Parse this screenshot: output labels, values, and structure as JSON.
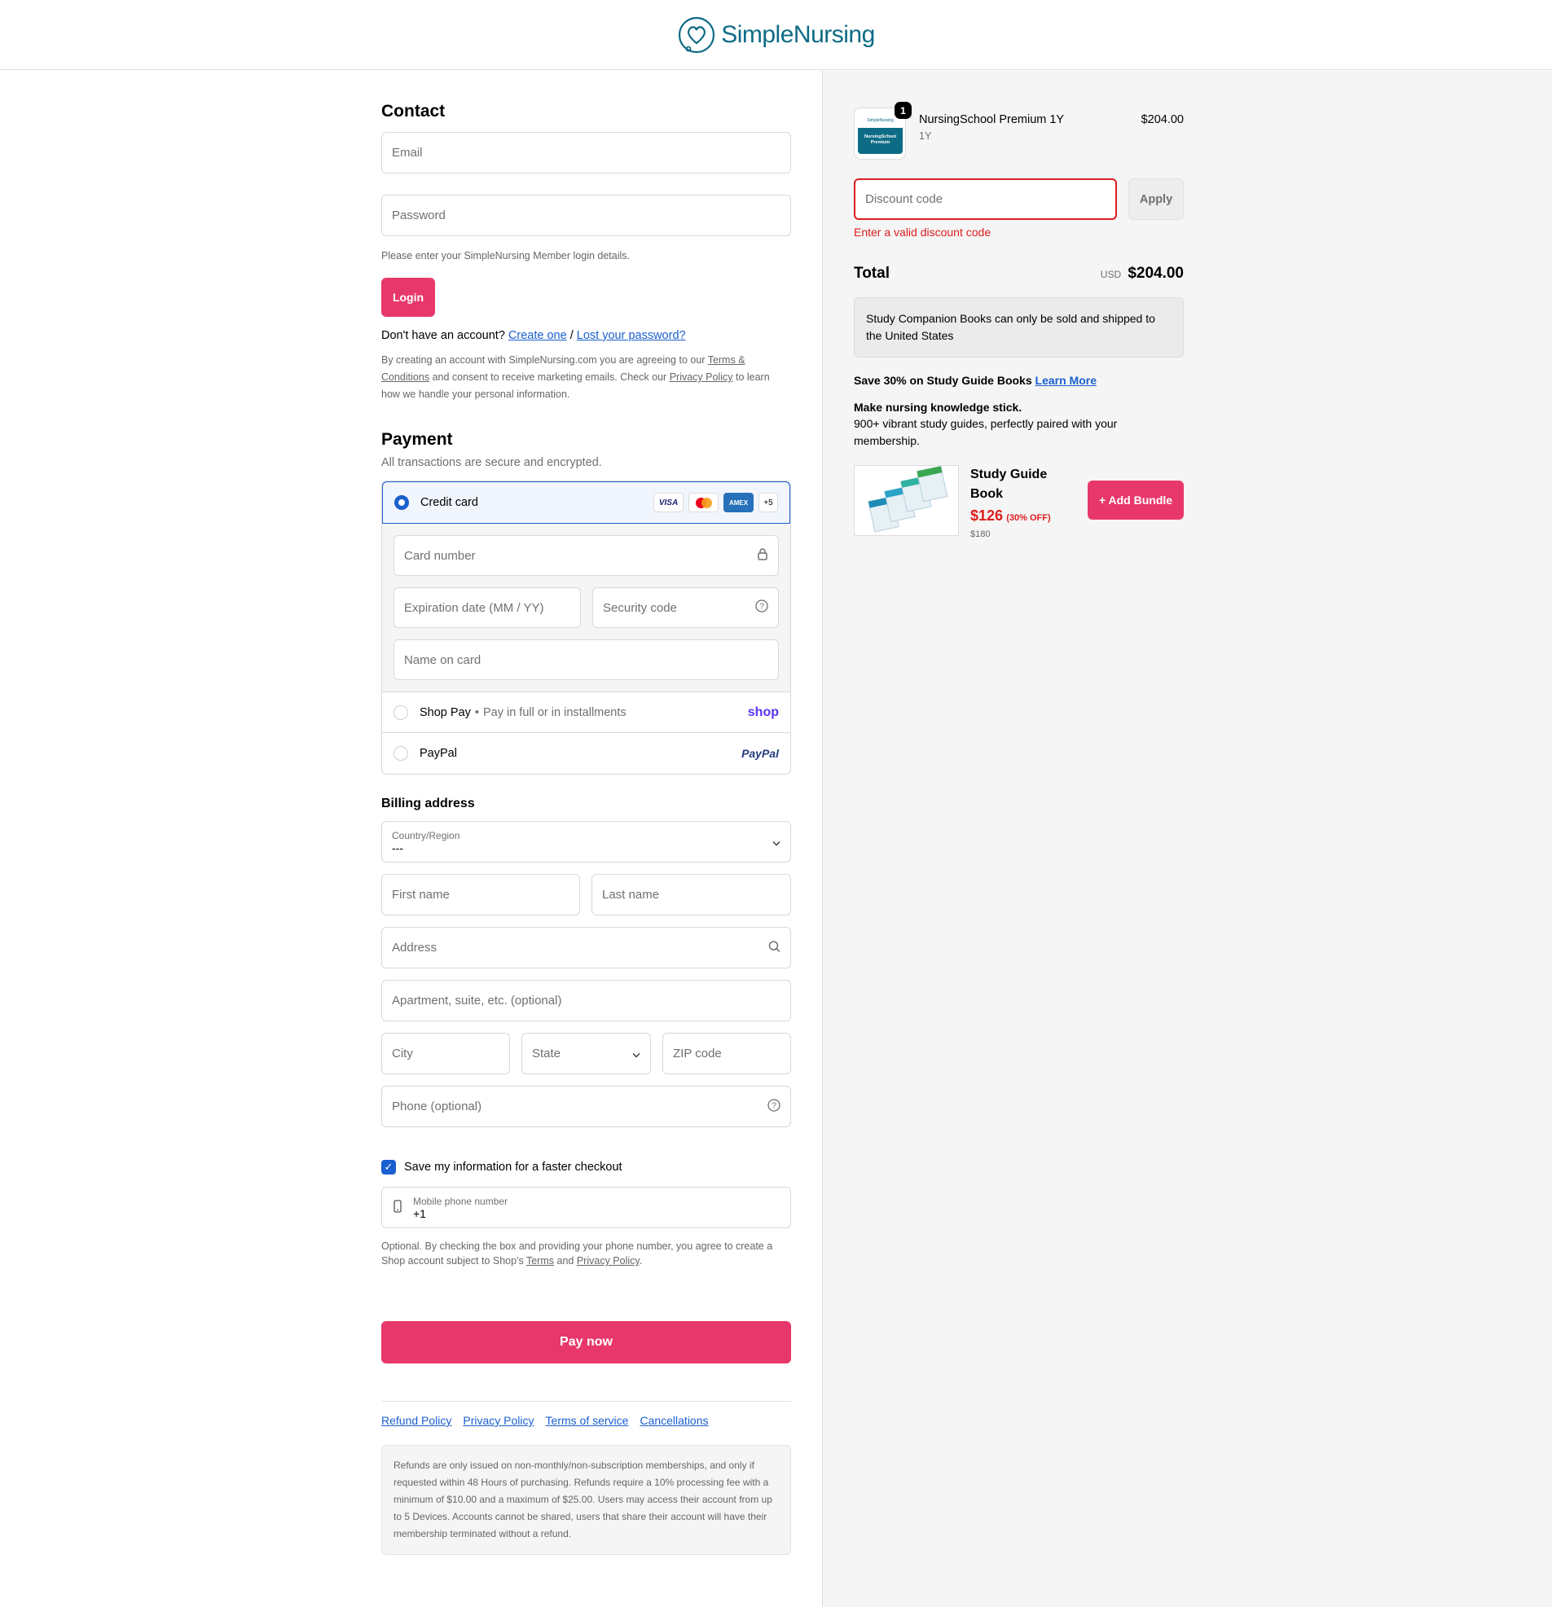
{
  "brand": {
    "name": "SimpleNursing",
    "color": "#0e6b86",
    "accent": "#e8386b",
    "link": "#1a5fcf",
    "error": "#dd1d1d"
  },
  "contact": {
    "title": "Contact",
    "email_placeholder": "Email",
    "password_placeholder": "Password",
    "hint": "Please enter your SimpleNursing Member login details.",
    "login_label": "Login",
    "no_account": "Don't have an account?",
    "create_link": "Create one",
    "separator": "/",
    "lost_link": "Lost your password?",
    "terms_prefix": "By creating an account with SimpleNursing.com you are agreeing to our",
    "terms_link": "Terms & Conditions",
    "terms_mid": "and consent to receive marketing emails. Check our",
    "privacy_link": "Privacy Policy",
    "terms_suffix": "to learn how we handle your personal information."
  },
  "payment": {
    "title": "Payment",
    "subtitle": "All transactions are secure and encrypted.",
    "credit_card": "Credit card",
    "card_logos": [
      "VISA",
      "MC",
      "AMEX",
      "+5"
    ],
    "card_number": "Card number",
    "expiration": "Expiration date (MM / YY)",
    "security": "Security code",
    "name_on_card": "Name on card",
    "shop_pay": "Shop Pay",
    "shop_pay_sub": "Pay in full or in installments",
    "shop_logo": "shop",
    "paypal": "PayPal",
    "paypal_logo": "PayPal"
  },
  "billing": {
    "title": "Billing address",
    "country_label": "Country/Region",
    "country_value": "---",
    "first_name": "First name",
    "last_name": "Last name",
    "address": "Address",
    "apartment": "Apartment, suite, etc. (optional)",
    "city": "City",
    "state": "State",
    "zip": "ZIP code",
    "phone": "Phone (optional)"
  },
  "save_info": {
    "label": "Save my information for a faster checkout",
    "checked": true,
    "mobile_label": "Mobile phone number",
    "mobile_value": "+1",
    "optional_text": "Optional. By checking the box and providing your phone number, you agree to create a Shop account subject to Shop's",
    "terms": "Terms",
    "and": "and",
    "privacy": "Privacy Policy",
    "period": "."
  },
  "pay_now": "Pay now",
  "footer": {
    "links": [
      "Refund Policy",
      "Privacy Policy",
      "Terms of service",
      "Cancellations"
    ],
    "note": "Refunds are only issued on non-monthly/non-subscription memberships, and only if requested within 48 Hours of purchasing. Refunds require a 10% processing fee with a minimum of $10.00 and a maximum of $25.00. Users may access their account from up to 5 Devices. Accounts cannot be shared, users that share their account will have their membership terminated without a refund."
  },
  "summary": {
    "item_name": "NursingSchool Premium 1Y",
    "item_variant": "1Y",
    "item_qty": "1",
    "item_price": "$204.00",
    "thumb_brand": "SimpleNursing",
    "thumb_title": "NursingSchool Premium",
    "discount_placeholder": "Discount code",
    "apply": "Apply",
    "discount_error": "Enter a valid discount code",
    "total_label": "Total",
    "currency": "USD",
    "total": "$204.00",
    "notice": "Study Companion Books can only be sold and shipped to the United States",
    "save_promo": "Save 30% on Study Guide Books",
    "learn_more": "Learn More",
    "knowledge_title": "Make nursing knowledge stick.",
    "knowledge_body": "900+ vibrant study guides, perfectly paired with your membership.",
    "book_title": "Study Guide Book",
    "book_price": "$126",
    "book_off": "(30% OFF)",
    "book_orig": "$180",
    "add_bundle": "+ Add Bundle"
  }
}
